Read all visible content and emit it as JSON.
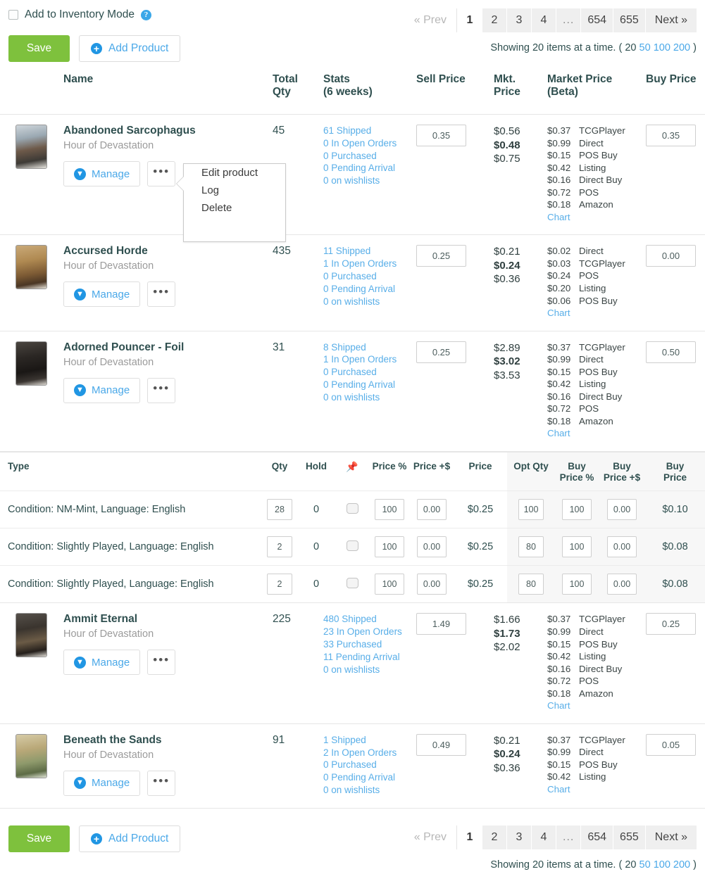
{
  "header": {
    "inventory_mode_label": "Add to Inventory Mode",
    "help_icon": "question-circle-icon",
    "save_label": "Save",
    "add_product_label": "Add Product",
    "plus_icon": "plus-circle-icon"
  },
  "pagination": {
    "prev_label": "« Prev",
    "next_label": "Next »",
    "pages": [
      "1",
      "2",
      "3",
      "4",
      "...",
      "654",
      "655"
    ],
    "active_page": "1",
    "showing_prefix": "Showing 20 items at a time. ( 20",
    "page_size_options": [
      "50",
      "100",
      "200"
    ],
    "showing_suffix": ")"
  },
  "columns": {
    "name": "Name",
    "total_qty_1": "Total",
    "total_qty_2": "Qty",
    "stats_1": "Stats",
    "stats_2": "(6 weeks)",
    "sell_price": "Sell Price",
    "mkt_price_1": "Mkt.",
    "mkt_price_2": "Price",
    "market_price_1": "Market Price",
    "market_price_2": "(Beta)",
    "buy_price": "Buy Price"
  },
  "row_actions": {
    "manage_label": "Manage",
    "download_icon": "download-circle-icon",
    "dots_label": "•••",
    "chart_label": "Chart"
  },
  "dropdown": {
    "items": [
      "Edit product",
      "Log",
      "Delete"
    ]
  },
  "sub_table": {
    "headers": {
      "type": "Type",
      "qty": "Qty",
      "hold": "Hold",
      "pin": "pin-icon",
      "price_pct": "Price %",
      "price_plus": "Price +$",
      "price": "Price",
      "opt_qty": "Opt Qty",
      "buy_price_pct_1": "Buy",
      "buy_price_pct_2": "Price %",
      "buy_price_plus_1": "Buy",
      "buy_price_plus_2": "Price +$",
      "buy_price_1": "Buy",
      "buy_price_2": "Price"
    },
    "rows": [
      {
        "type": "Condition: NM-Mint, Language: English",
        "qty": "28",
        "hold": "0",
        "price_pct": "100",
        "price_plus": "0.00",
        "price": "$0.25",
        "opt_qty": "100",
        "buy_price_pct": "100",
        "buy_price_plus": "0.00",
        "buy_price": "$0.10"
      },
      {
        "type": "Condition: Slightly Played, Language: English",
        "qty": "2",
        "hold": "0",
        "price_pct": "100",
        "price_plus": "0.00",
        "price": "$0.25",
        "opt_qty": "80",
        "buy_price_pct": "100",
        "buy_price_plus": "0.00",
        "buy_price": "$0.08"
      },
      {
        "type": "Condition: Slightly Played, Language: English",
        "qty": "2",
        "hold": "0",
        "price_pct": "100",
        "price_plus": "0.00",
        "price": "$0.25",
        "opt_qty": "80",
        "buy_price_pct": "100",
        "buy_price_plus": "0.00",
        "buy_price": "$0.08"
      }
    ]
  },
  "products": [
    {
      "name": "Abandoned Sarcophagus",
      "set": "Hour of Devastation",
      "total_qty": "45",
      "stats": [
        "61 Shipped",
        "0 In Open Orders",
        "0 Purchased",
        "0 Pending Arrival",
        "0 on wishlists"
      ],
      "sell_price": "0.35",
      "mkt_low": "$0.56",
      "mkt_mid": "$0.48",
      "mkt_high": "$0.75",
      "market_prices": [
        {
          "amount": "$0.37",
          "source": "TCGPlayer"
        },
        {
          "amount": "$0.99",
          "source": "Direct"
        },
        {
          "amount": "$0.15",
          "source": "POS Buy"
        },
        {
          "amount": "$0.42",
          "source": "Listing"
        },
        {
          "amount": "$0.16",
          "source": "Direct Buy"
        },
        {
          "amount": "$0.72",
          "source": "POS"
        },
        {
          "amount": "$0.18",
          "source": "Amazon"
        }
      ],
      "buy_price": "0.35"
    },
    {
      "name": "Accursed Horde",
      "set": "Hour of Devastation",
      "total_qty": "435",
      "stats": [
        "11 Shipped",
        "1 In Open Orders",
        "0 Purchased",
        "0 Pending Arrival",
        "0 on wishlists"
      ],
      "sell_price": "0.25",
      "mkt_low": "$0.21",
      "mkt_mid": "$0.24",
      "mkt_high": "$0.36",
      "market_prices": [
        {
          "amount": "$0.02",
          "source": "Direct"
        },
        {
          "amount": "$0.03",
          "source": "TCGPlayer"
        },
        {
          "amount": "$0.24",
          "source": "POS"
        },
        {
          "amount": "$0.20",
          "source": "Listing"
        },
        {
          "amount": "$0.06",
          "source": "POS Buy"
        }
      ],
      "buy_price": "0.00"
    },
    {
      "name": "Adorned Pouncer - Foil",
      "set": "Hour of Devastation",
      "total_qty": "31",
      "stats": [
        "8 Shipped",
        "1 In Open Orders",
        "0 Purchased",
        "0 Pending Arrival",
        "0 on wishlists"
      ],
      "sell_price": "0.25",
      "mkt_low": "$2.89",
      "mkt_mid": "$3.02",
      "mkt_high": "$3.53",
      "market_prices": [
        {
          "amount": "$0.37",
          "source": "TCGPlayer"
        },
        {
          "amount": "$0.99",
          "source": "Direct"
        },
        {
          "amount": "$0.15",
          "source": "POS Buy"
        },
        {
          "amount": "$0.42",
          "source": "Listing"
        },
        {
          "amount": "$0.16",
          "source": "Direct Buy"
        },
        {
          "amount": "$0.72",
          "source": "POS"
        },
        {
          "amount": "$0.18",
          "source": "Amazon"
        }
      ],
      "buy_price": "0.50"
    },
    {
      "name": "Ammit Eternal",
      "set": "Hour of Devastation",
      "total_qty": "225",
      "stats": [
        "480 Shipped",
        "23 In Open Orders",
        "33 Purchased",
        "11 Pending Arrival",
        "0 on wishlists"
      ],
      "sell_price": "1.49",
      "mkt_low": "$1.66",
      "mkt_mid": "$1.73",
      "mkt_high": "$2.02",
      "market_prices": [
        {
          "amount": "$0.37",
          "source": "TCGPlayer"
        },
        {
          "amount": "$0.99",
          "source": "Direct"
        },
        {
          "amount": "$0.15",
          "source": "POS Buy"
        },
        {
          "amount": "$0.42",
          "source": "Listing"
        },
        {
          "amount": "$0.16",
          "source": "Direct Buy"
        },
        {
          "amount": "$0.72",
          "source": "POS"
        },
        {
          "amount": "$0.18",
          "source": "Amazon"
        }
      ],
      "buy_price": "0.25"
    },
    {
      "name": "Beneath the Sands",
      "set": "Hour of Devastation",
      "total_qty": "91",
      "stats": [
        "1 Shipped",
        "2 In Open Orders",
        "0 Purchased",
        "0 Pending Arrival",
        "0 on wishlists"
      ],
      "sell_price": "0.49",
      "mkt_low": "$0.21",
      "mkt_mid": "$0.24",
      "mkt_high": "$0.36",
      "market_prices": [
        {
          "amount": "$0.37",
          "source": "TCGPlayer"
        },
        {
          "amount": "$0.99",
          "source": "Direct"
        },
        {
          "amount": "$0.15",
          "source": "POS Buy"
        },
        {
          "amount": "$0.42",
          "source": "Listing"
        }
      ],
      "buy_price": "0.05"
    }
  ],
  "colors": {
    "accent_blue": "#4aa8e8",
    "save_green": "#7ec13d",
    "text_dark": "#2f4f4f"
  }
}
